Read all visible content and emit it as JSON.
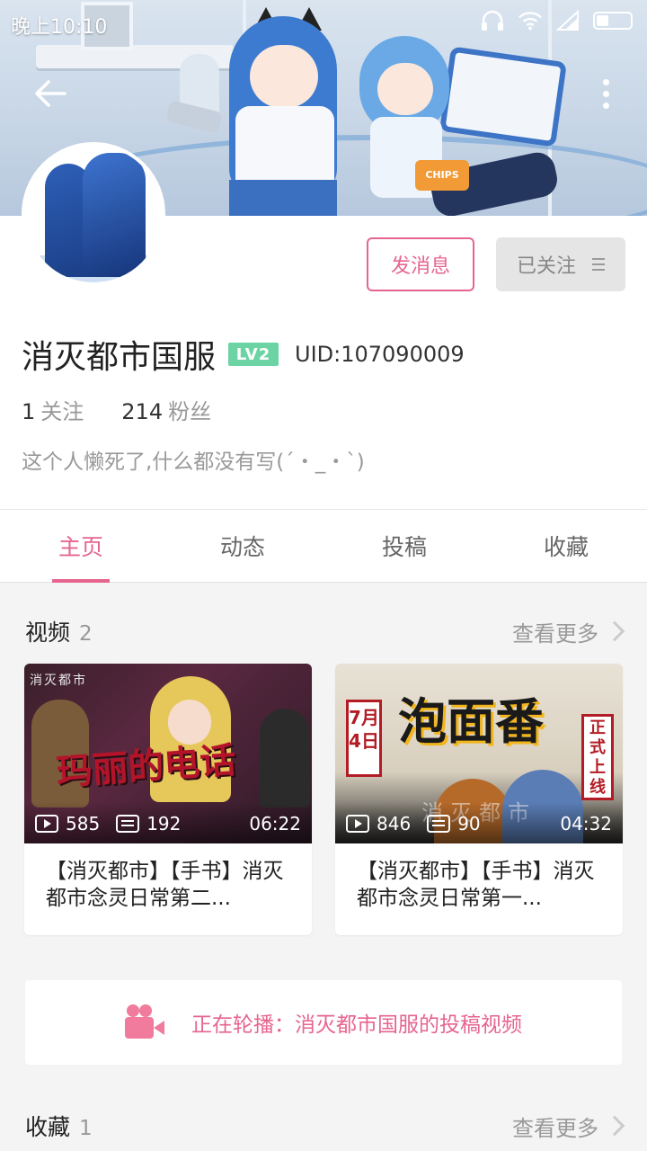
{
  "status_bar": {
    "time": "晚上10:10",
    "icons": [
      "headphones-icon",
      "wifi-icon",
      "signal-icon",
      "battery-icon"
    ],
    "battery_level": 0.35
  },
  "header": {
    "back_icon": "arrow-left-icon",
    "more_icon": "more-vertical-icon"
  },
  "profile": {
    "name": "消灭都市国服",
    "level": "LV2",
    "uid": "UID:107090009",
    "following_count": "1",
    "following_label": "关注",
    "followers_count": "214",
    "followers_label": "粉丝",
    "bio": "这个人懒死了,什么都没有写(´・_・`)",
    "message_button": "发消息",
    "follow_button": "已关注"
  },
  "tabs": [
    {
      "label": "主页",
      "active": true
    },
    {
      "label": "动态",
      "active": false
    },
    {
      "label": "投稿",
      "active": false
    },
    {
      "label": "收藏",
      "active": false
    }
  ],
  "videos_section": {
    "title": "视频",
    "count": "2",
    "see_more": "查看更多",
    "items": [
      {
        "thumb_text": "玛丽的电话",
        "thumb_logo": "消灭都市",
        "plays": "585",
        "danmaku": "192",
        "duration": "06:22",
        "title": "【消灭都市】【手书】消灭都市念灵日常第二..."
      },
      {
        "thumb_text": "泡面番",
        "thumb_date": "7月4日",
        "thumb_online": "正式上线",
        "thumb_watermark": "消灭都市",
        "plays": "846",
        "danmaku": "90",
        "duration": "04:32",
        "title": "【消灭都市】【手书】消灭都市念灵日常第一..."
      }
    ]
  },
  "carousel": {
    "icon": "video-camera-icon",
    "text": "正在轮播：消灭都市国服的投稿视频"
  },
  "favorites_section": {
    "title": "收藏",
    "count": "1",
    "see_more": "查看更多"
  },
  "colors": {
    "accent": "#e6658f",
    "level_badge": "#6cd4a4",
    "follow_bg": "#e5e5e5"
  }
}
